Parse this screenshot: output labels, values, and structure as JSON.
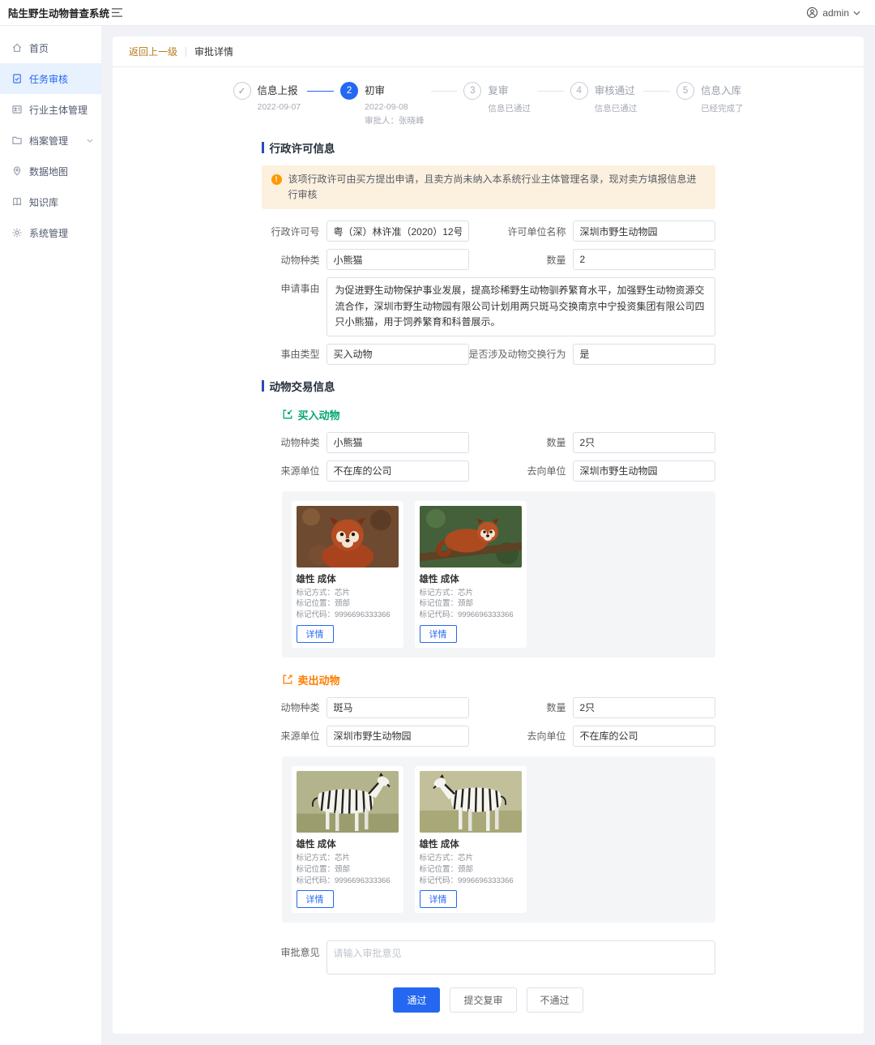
{
  "colors": {
    "primary": "#2468f2",
    "buy_green": "#00a76d",
    "sell_orange": "#ff7d00",
    "warning_bg": "#fcf0df",
    "sidebar_active_bg": "#e8f1fe"
  },
  "app": {
    "title": "陆生野生动物普查系统",
    "user": "admin"
  },
  "sidebar": {
    "items": [
      {
        "label": "首页"
      },
      {
        "label": "任务审核"
      },
      {
        "label": "行业主体管理"
      },
      {
        "label": "档案管理"
      },
      {
        "label": "数据地图"
      },
      {
        "label": "知识库"
      },
      {
        "label": "系统管理"
      }
    ]
  },
  "breadcrumb": {
    "back": "返回上一级",
    "current": "审批详情"
  },
  "steps": [
    {
      "glyph": "✓",
      "label": "信息上报",
      "line1": "2022-09-07"
    },
    {
      "glyph": "2",
      "label": "初审",
      "line1": "2022-09-08",
      "line2": "审批人：张晓峰"
    },
    {
      "glyph": "3",
      "label": "复审",
      "line1": "信息已通过"
    },
    {
      "glyph": "4",
      "label": "审核通过",
      "line1": "信息已通过"
    },
    {
      "glyph": "5",
      "label": "信息入库",
      "line1": "已经完成了"
    }
  ],
  "permit": {
    "section_title": "行政许可信息",
    "warning": "该项行政许可由买方提出申请，且卖方尚未纳入本系统行业主体管理名录，现对卖方填报信息进行审核",
    "permit_no": {
      "label": "行政许可号",
      "value": "粤（深）林许准（2020）12号"
    },
    "permit_unit": {
      "label": "许可单位名称",
      "value": "深圳市野生动物园"
    },
    "species": {
      "label": "动物种类",
      "value": "小熊猫"
    },
    "quantity": {
      "label": "数量",
      "value": "2"
    },
    "reason": {
      "label": "申请事由",
      "value": "为促进野生动物保护事业发展，提高珍稀野生动物驯养繁育水平，加强野生动物资源交流合作，深圳市野生动物园有限公司计划用两只斑马交换南京中宁投资集团有限公司四只小熊猫，用于饲养繁育和科普展示。"
    },
    "reason_type": {
      "label": "事由类型",
      "value": "买入动物"
    },
    "exchange": {
      "label": "是否涉及动物交换行为",
      "value": "是"
    }
  },
  "trade": {
    "section_title": "动物交易信息",
    "buy": {
      "title": "买入动物",
      "species": {
        "label": "动物种类",
        "value": "小熊猫"
      },
      "quantity": {
        "label": "数量",
        "value": "2只"
      },
      "source": {
        "label": "来源单位",
        "value": "不在库的公司"
      },
      "dest": {
        "label": "去向单位",
        "value": "深圳市野生动物园"
      },
      "animals": [
        {
          "title": "雄性 成体",
          "mark_method": "标记方式：芯片",
          "mark_position": "标记位置：颈部",
          "mark_code": "标记代码：9996696333366",
          "detail_label": "详情"
        },
        {
          "title": "雄性 成体",
          "mark_method": "标记方式：芯片",
          "mark_position": "标记位置：颈部",
          "mark_code": "标记代码：9996696333366",
          "detail_label": "详情"
        }
      ]
    },
    "sell": {
      "title": "卖出动物",
      "species": {
        "label": "动物种类",
        "value": "斑马"
      },
      "quantity": {
        "label": "数量",
        "value": "2只"
      },
      "source": {
        "label": "来源单位",
        "value": "深圳市野生动物园"
      },
      "dest": {
        "label": "去向单位",
        "value": "不在库的公司"
      },
      "animals": [
        {
          "title": "雄性 成体",
          "mark_method": "标记方式：芯片",
          "mark_position": "标记位置：颈部",
          "mark_code": "标记代码：9996696333366",
          "detail_label": "详情"
        },
        {
          "title": "雄性 成体",
          "mark_method": "标记方式：芯片",
          "mark_position": "标记位置：颈部",
          "mark_code": "标记代码：9996696333366",
          "detail_label": "详情"
        }
      ]
    }
  },
  "approval": {
    "label": "审批意见",
    "placeholder": "请输入审批意见",
    "pass_label": "通过",
    "resubmit_label": "提交复审",
    "reject_label": "不通过"
  }
}
